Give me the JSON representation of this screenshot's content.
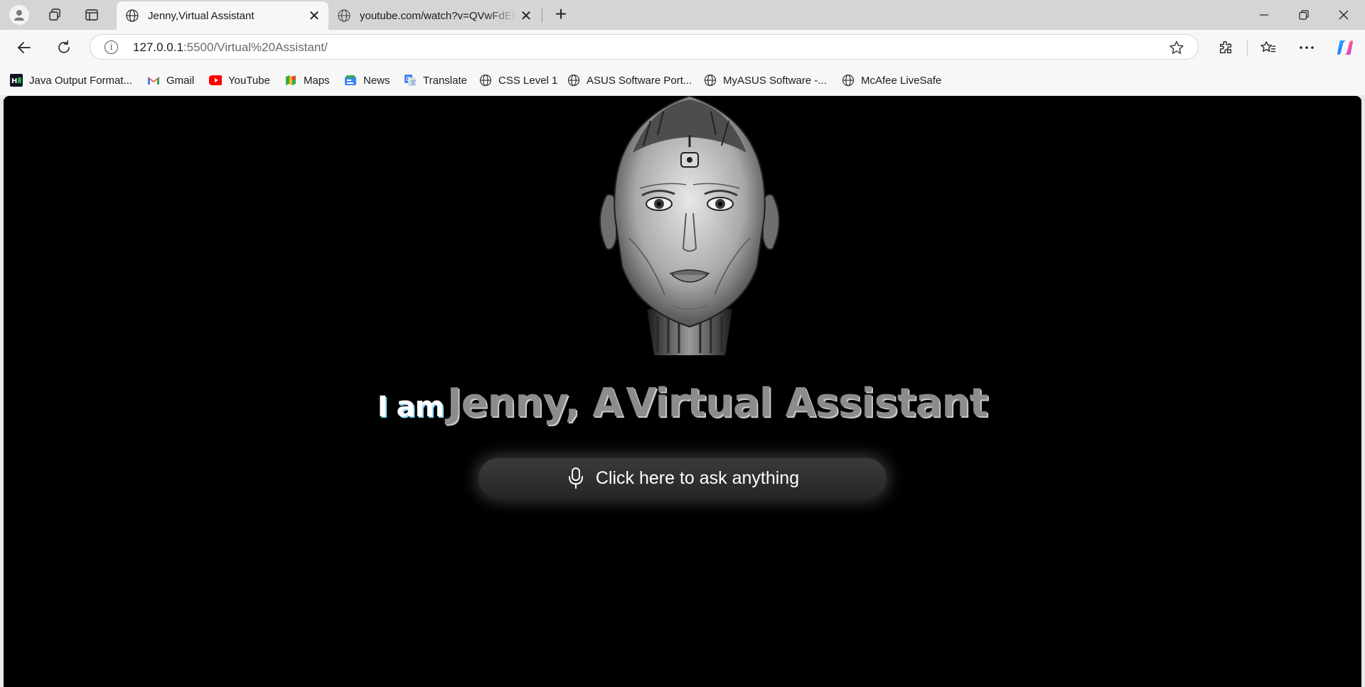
{
  "browser": {
    "tabs": [
      {
        "title": "Jenny,Virtual Assistant",
        "active": true
      },
      {
        "title": "youtube.com/watch?v=QVwFdEhJQTo",
        "active": false
      }
    ],
    "url_host": "127.0.0.1",
    "url_path": ":5500/Virtual%20Assistant/"
  },
  "bookmarks": [
    {
      "label": "Java Output Format...",
      "icon": "hackerrank-icon"
    },
    {
      "label": "Gmail",
      "icon": "gmail-icon"
    },
    {
      "label": "YouTube",
      "icon": "youtube-icon"
    },
    {
      "label": "Maps",
      "icon": "maps-icon"
    },
    {
      "label": "News",
      "icon": "news-icon"
    },
    {
      "label": "Translate",
      "icon": "translate-icon"
    },
    {
      "label": "CSS Level 1",
      "icon": "globe-icon"
    },
    {
      "label": "ASUS Software Port...",
      "icon": "globe-icon"
    },
    {
      "label": "MyASUS Software -...",
      "icon": "globe-icon"
    },
    {
      "label": "McAfee LiveSafe",
      "icon": "globe-icon"
    }
  ],
  "page": {
    "headline_part1": "I am",
    "headline_part2": "Jenny, A",
    "headline_part3": "Virtual Assistant",
    "ask_button": "Click here to ask anything"
  },
  "colors": {
    "page_background": "#000000",
    "headline_white": "#ffffff",
    "headline_gray": "#8c8c8c",
    "button_background": "#2f2f2f"
  }
}
